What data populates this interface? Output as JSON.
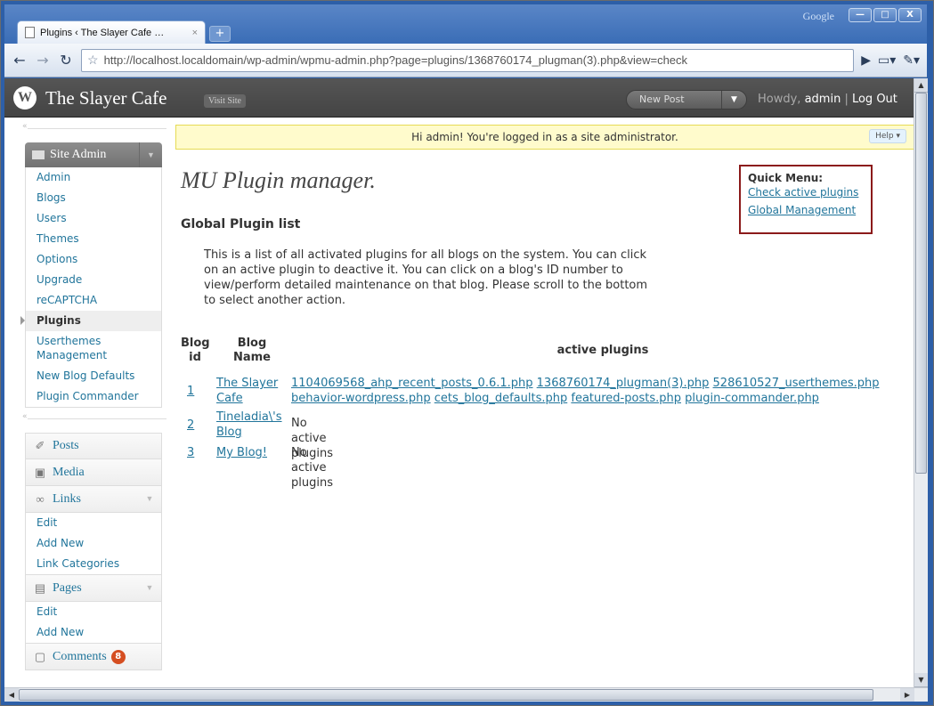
{
  "browser": {
    "tab_title": "Plugins ‹ The Slayer Cafe …",
    "tab_close": "×",
    "new_tab": "+",
    "brand": "Google",
    "url_host": "http://localhost.localdomain",
    "url_path": "/wp-admin/wpmu-admin.php?page=plugins/1368760174_plugman(3).php&view=check"
  },
  "wp_header": {
    "site_name": "The Slayer Cafe",
    "visit_site": "Visit Site",
    "new_post": "New Post",
    "howdy_prefix": "Howdy, ",
    "user": "admin",
    "separator": " | ",
    "logout": "Log Out"
  },
  "notice": {
    "text": "Hi admin! You're logged in as a site administrator.",
    "help": "Help ▾"
  },
  "sidebar": {
    "site_admin": {
      "title": "Site Admin",
      "items": [
        "Admin",
        "Blogs",
        "Users",
        "Themes",
        "Options",
        "Upgrade",
        "reCAPTCHA",
        "Plugins",
        "Userthemes Management",
        "New Blog Defaults",
        "Plugin Commander"
      ],
      "current": "Plugins"
    },
    "posts": "Posts",
    "media": "Media",
    "links": {
      "title": "Links",
      "items": [
        "Edit",
        "Add New",
        "Link Categories"
      ]
    },
    "pages": {
      "title": "Pages",
      "items": [
        "Edit",
        "Add New"
      ]
    },
    "comments": {
      "title": "Comments",
      "count": "8"
    }
  },
  "main": {
    "title": "MU Plugin manager.",
    "section_title": "Global Plugin list",
    "description": "This is a list of all activated plugins for all blogs on the system. You can click on an active plugin to deactive it. You can click on a blog's ID number to view/perform detailed maintenance on that blog. Please scroll to the bottom to select another action.",
    "quick_menu": {
      "title": "Quick Menu:",
      "links": [
        "Check active plugins",
        "Global Management"
      ]
    },
    "table": {
      "headers": {
        "blog_id": "Blog id",
        "blog_name": "Blog Name",
        "active": "active plugins"
      },
      "rows": [
        {
          "id": "1",
          "name": "The Slayer Cafe",
          "plugins": [
            "1104069568_ahp_recent_posts_0.6.1.php",
            "1368760174_plugman(3).php",
            "528610527_userthemes.php",
            "behavior-wordpress.php",
            "cets_blog_defaults.php",
            "featured-posts.php",
            "plugin-commander.php"
          ]
        },
        {
          "id": "2",
          "name": "Tineladia\\'s Blog",
          "none": "No active plugins"
        },
        {
          "id": "3",
          "name": "My Blog!",
          "none": "No active plugins"
        }
      ]
    }
  }
}
